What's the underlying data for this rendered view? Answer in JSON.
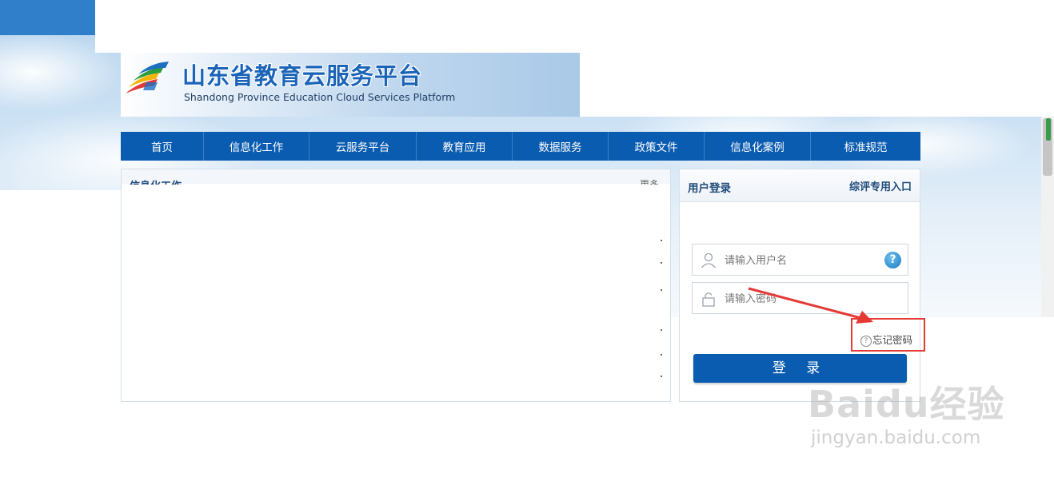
{
  "header": {
    "title": "山东省教育云服务平台",
    "subtitle": "Shandong Province Education Cloud Services Platform"
  },
  "nav": {
    "items": [
      "首页",
      "信息化工作",
      "云服务平台",
      "教育应用",
      "数据服务",
      "政策文件",
      "信息化案例",
      "标准规范"
    ]
  },
  "left_panel": {
    "title": "信息化工作",
    "more": "更多"
  },
  "login": {
    "title": "用户登录",
    "special_entry": "综评专用入口",
    "username_placeholder": "请输入用户名",
    "password_placeholder": "请输入密码",
    "help_icon_label": "?",
    "forgot_password": "忘记密码",
    "login_button": "登 录"
  },
  "annotation": {
    "highlight_color": "#e53935"
  },
  "watermark": {
    "brand": "Baidu经验",
    "url": "jingyan.baidu.com"
  },
  "colors": {
    "nav_bg": "#0a5cb1",
    "accent": "#1b64b8"
  }
}
